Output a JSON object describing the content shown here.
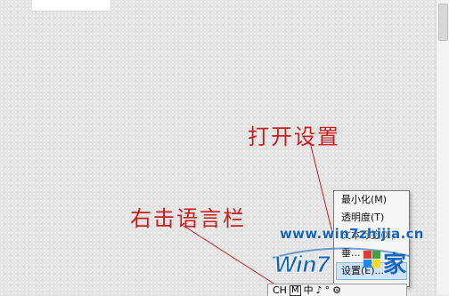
{
  "annotations": {
    "open_settings": "打开设置",
    "right_click_language_bar": "右击语言栏"
  },
  "context_menu": {
    "items": [
      {
        "label": "最小化(M)"
      },
      {
        "label": "透明度(T)"
      },
      {
        "label": "文本标签(X)"
      },
      {
        "label": "垂..."
      },
      {
        "label": "设置(E)..."
      }
    ],
    "selected_index": 4
  },
  "watermark": {
    "url": "www.win7zhijia.cn",
    "logo_text": "Win7",
    "logo_suffix": "家"
  },
  "language_bar": {
    "lang": "CH",
    "mode_box": "M",
    "input": "中",
    "moon": "♪",
    "dot": "°",
    "gear": "⚙"
  },
  "colors": {
    "annotation": "#c81e1e",
    "selection": "#cfe3f7",
    "logo_blue": "#1565c0"
  }
}
